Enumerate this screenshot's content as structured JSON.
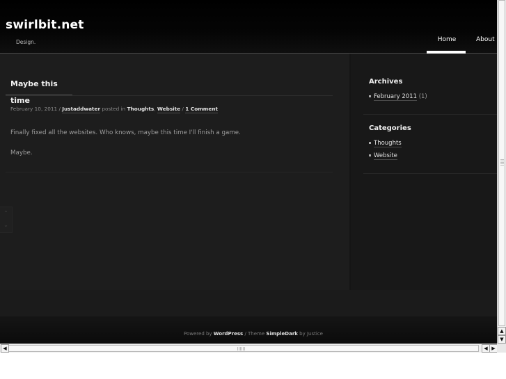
{
  "site": {
    "title": "swirlbit.net",
    "tagline": "Design."
  },
  "nav": {
    "home": "Home",
    "about": "About"
  },
  "post": {
    "title": "Maybe this time",
    "meta": {
      "date": "February 10, 2011",
      "sep": " / ",
      "author": "Justaddwater",
      "posted_in": " posted in ",
      "cat1": "Thoughts",
      "comma": ", ",
      "cat2": "Website",
      "sep2": " / ",
      "comments": "1 Comment"
    },
    "body": [
      "Finally fixed all the websites. Who knows, maybe this time I'll finish a game.",
      "Maybe."
    ]
  },
  "sidebar": {
    "archives": {
      "title": "Archives",
      "items": [
        {
          "label": "February 2011",
          "count": "(1)"
        }
      ]
    },
    "categories": {
      "title": "Categories",
      "items": [
        {
          "label": "Thoughts"
        },
        {
          "label": "Website"
        }
      ]
    }
  },
  "footer": {
    "powered_by": "Powered by ",
    "wordpress": "WordPress",
    "theme_sep": " / Theme ",
    "theme": "SimpleDark",
    "by": " by Justice"
  },
  "scroll_arrows": {
    "up": "⌃",
    "down": "⌄"
  },
  "scrollbar_glyphs": {
    "up": "▲",
    "down": "▼",
    "left": "◀",
    "right": "▶"
  }
}
